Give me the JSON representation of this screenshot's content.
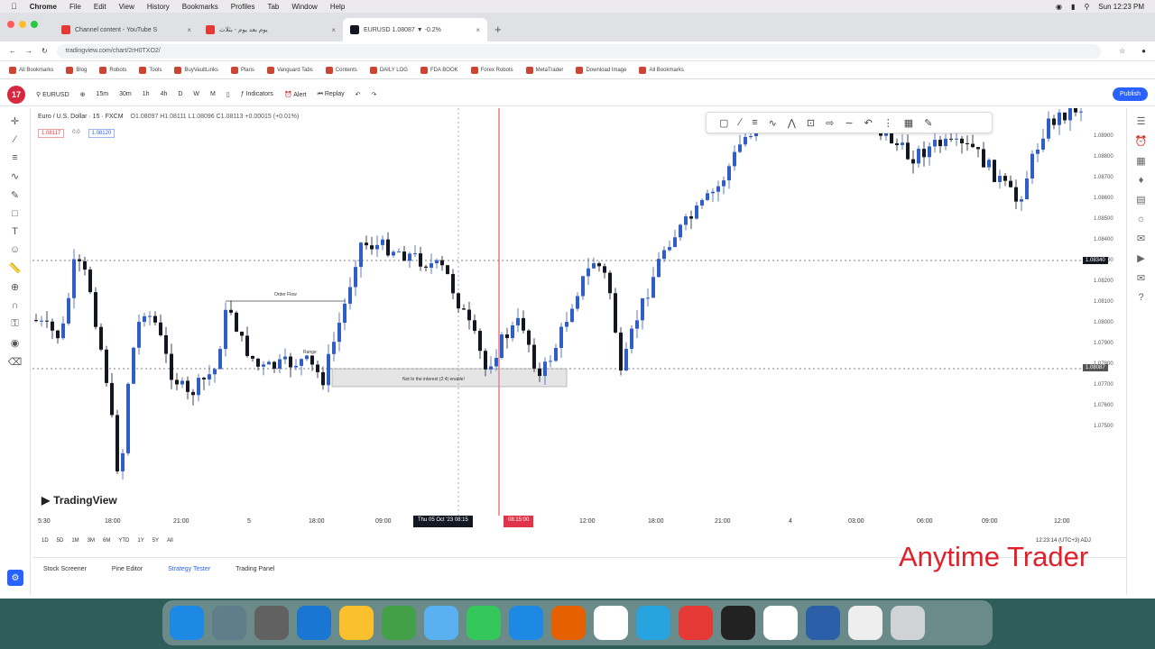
{
  "menubar": {
    "app": "Chrome",
    "items": [
      "File",
      "Edit",
      "View",
      "History",
      "Bookmarks",
      "Profiles",
      "Tab",
      "Window",
      "Help"
    ],
    "clock": "Sun 12:23 PM"
  },
  "tabs": [
    {
      "label": "Channel content - YouTube S",
      "color": "#e53935",
      "active": false
    },
    {
      "label": "يوم بعد يوم - بثلاث",
      "color": "#e53935",
      "active": false
    },
    {
      "label": "EURUSD 1.08087 ▼ -0.2%",
      "color": "#131722",
      "active": true
    }
  ],
  "address": {
    "url": "tradingview.com/chart/2rH0TXO2/"
  },
  "bookmarks": [
    "All Bookmarks",
    "Blog",
    "Robots",
    "Tools",
    "BuyVaultLinks",
    "Plans",
    "Vanguard Tabs",
    "Contents",
    "DAILY LOG",
    "FDA BOOK",
    "Forex Robots",
    "MetaTrader",
    "Download Image",
    "All Bookmarks"
  ],
  "tvtop": {
    "logo": "17",
    "symbol": "EURUSD",
    "intervals": [
      "15m",
      "30m",
      "1h",
      "4h",
      "D",
      "W",
      "M"
    ],
    "indicators": "Indicators",
    "alert": "Alert",
    "replay": "Replay",
    "publish": "Publish"
  },
  "legend": {
    "name": "Euro / U.S. Dollar · 15 · FXCM",
    "ohlc": "O1.08097 H1.08111 L1.08096 C1.08113 +0.00015 (+0.01%)"
  },
  "price_boxes": {
    "bid": "1.08117",
    "spread": "0.0",
    "ask": "1.08120"
  },
  "chart": {
    "labels": [
      "Order Flow",
      "Range",
      "Not In the interest (2:4) enable!"
    ],
    "price_ticks": [
      "1.08900",
      "1.08800",
      "1.08700",
      "1.08600",
      "1.08500",
      "1.08400",
      "1.08300",
      "1.08200",
      "1.08100",
      "1.08000",
      "1.07900",
      "1.07800",
      "1.07700",
      "1.07600",
      "1.07500"
    ],
    "price_labels": [
      "1.08340",
      "1.08087"
    ],
    "time_ticks": [
      "5:30",
      "18:00",
      "21:00",
      "5",
      "18:00",
      "09:00",
      "12:00",
      "18:00",
      "21:00",
      "4",
      "03:00",
      "06:00",
      "09:00",
      "12:00"
    ],
    "crosshair_time": "Thu 05 Oct '23  08:15",
    "crosshair_red": "08:15:00",
    "watermark": "TradingView"
  },
  "ranges": [
    "1D",
    "5D",
    "1M",
    "3M",
    "6M",
    "YTD",
    "1Y",
    "5Y",
    "All"
  ],
  "utc": "12:23:14 (UTC+3) ADJ",
  "bottom_tabs": [
    "Stock Screener",
    "Pine Editor",
    "Strategy Tester",
    "Trading Panel"
  ],
  "active_bottom_tab": "Strategy Tester",
  "overlay": "Anytime Trader",
  "dock": [
    {
      "name": "finder",
      "color": "#1e88e5"
    },
    {
      "name": "launchpad",
      "color": "#607d8b"
    },
    {
      "name": "system-settings",
      "color": "#616161"
    },
    {
      "name": "safari",
      "color": "#1976d2"
    },
    {
      "name": "notes",
      "color": "#fbc02d"
    },
    {
      "name": "maps",
      "color": "#43a047"
    },
    {
      "name": "messages",
      "color": "#5ab0f0"
    },
    {
      "name": "facetime",
      "color": "#34c759"
    },
    {
      "name": "app-store",
      "color": "#1e88e5"
    },
    {
      "name": "firefox",
      "color": "#e66000"
    },
    {
      "name": "chrome",
      "color": "#ffffff"
    },
    {
      "name": "telegram",
      "color": "#29a3e0"
    },
    {
      "name": "jforex",
      "color": "#e53935"
    },
    {
      "name": "terminal",
      "color": "#222222"
    },
    {
      "name": "capcut",
      "color": "#ffffff"
    },
    {
      "name": "quicktime",
      "color": "#2b5fa8"
    },
    {
      "name": "document",
      "color": "#eeeeee"
    },
    {
      "name": "trash",
      "color": "#cfd3d6"
    }
  ]
}
